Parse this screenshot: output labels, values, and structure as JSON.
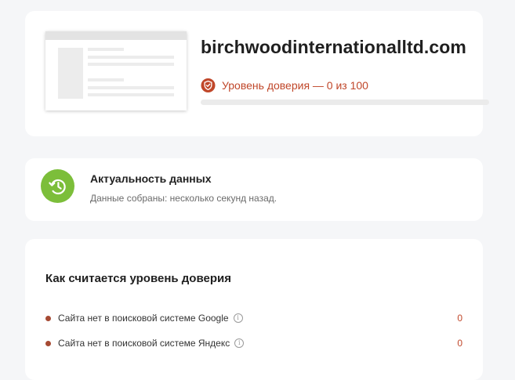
{
  "site": {
    "domain": "birchwoodinternationalltd.com",
    "trust_label": "Уровень доверия — 0 из 100",
    "trust_score": 0,
    "trust_max": 100,
    "trust_color": "#c0472a",
    "trust_icon": "shield-check-icon"
  },
  "freshness": {
    "icon": "clock-history-icon",
    "icon_color": "#7cbe3a",
    "title": "Актуальность данных",
    "subtitle": "Данные собраны: несколько секунд назад."
  },
  "calculation": {
    "title": "Как считается уровень доверия",
    "criteria": [
      {
        "label": "Сайта нет в поисковой системе Google",
        "score": "0"
      },
      {
        "label": "Сайта нет в поисковой системе Яндекс",
        "score": "0"
      }
    ]
  }
}
